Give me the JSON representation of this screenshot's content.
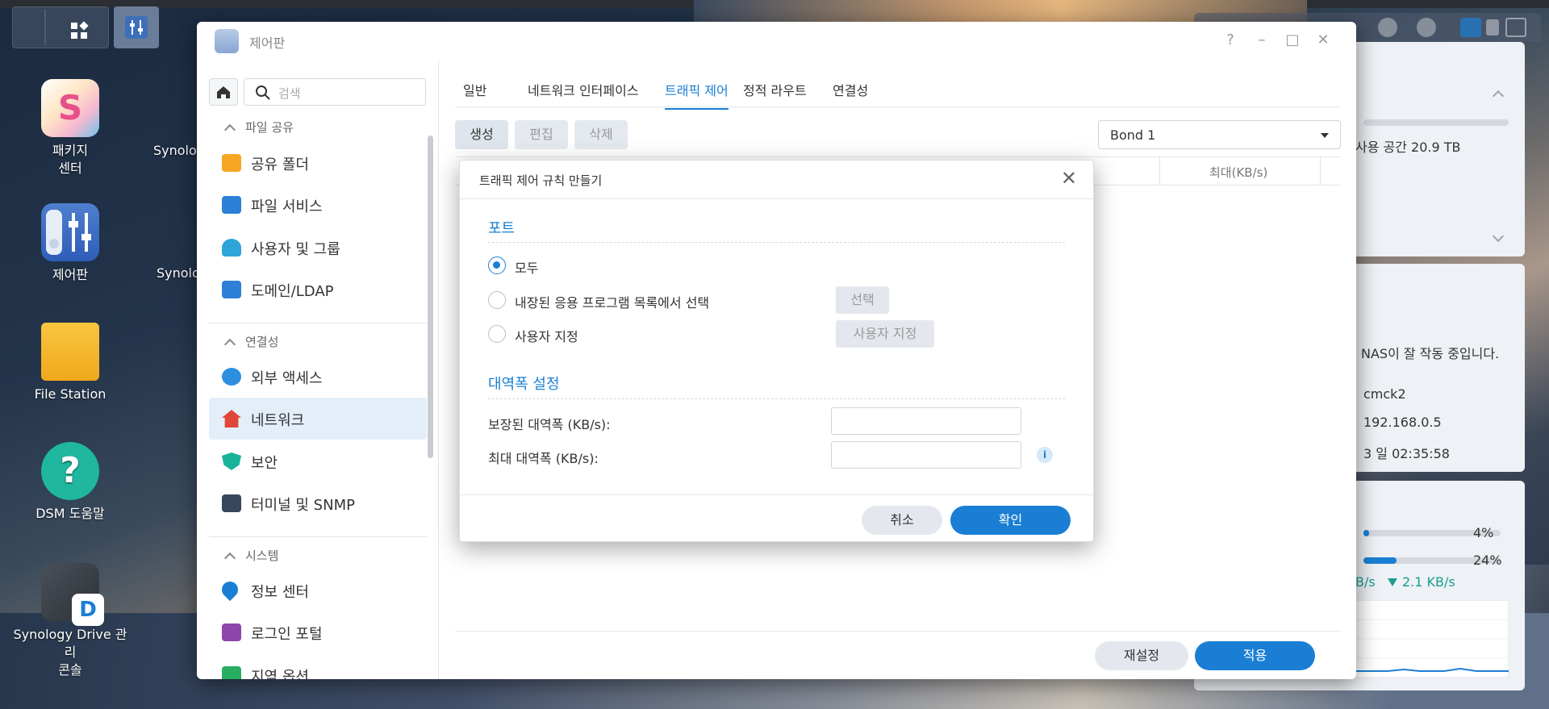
{
  "desktop": {
    "icons": [
      {
        "label_line1": "패키지",
        "label_line2": "센터"
      },
      {
        "label_line1": "제어판"
      },
      {
        "label_line1": "File Station"
      },
      {
        "label_line1": "DSM 도움말"
      },
      {
        "label_line1": "Synology Drive 관리",
        "label_line2": "콘솔"
      },
      {
        "label_line1": "Synolo"
      },
      {
        "label_line1": "Synolo"
      }
    ]
  },
  "widgets": {
    "storage_text": "사용 공간 20.9 TB",
    "health_text": "NAS이 잘 작동 중입니다.",
    "hostname": "cmck2",
    "ip": "192.168.0.5",
    "uptime": "3 일 02:35:58",
    "cpu": "4%",
    "ram": "24%",
    "upload": "B/s",
    "download": "2.1 KB/s",
    "cpu_level": 0.04,
    "ram_level": 0.24
  },
  "window": {
    "title": "제어판",
    "search_placeholder": "검색",
    "sidebar": {
      "sections": [
        {
          "label": "파일 공유"
        },
        {
          "label": "연결성"
        },
        {
          "label": "시스템"
        }
      ],
      "items": [
        {
          "label": "공유 폴더",
          "color": "#f5a623"
        },
        {
          "label": "파일 서비스",
          "color": "#2d7fd8"
        },
        {
          "label": "사용자 및 그룹",
          "color": "#2ea4d8"
        },
        {
          "label": "도메인/LDAP",
          "color": "#2d7fd8"
        },
        {
          "label": "외부 액세스",
          "color": "#2d8ee0"
        },
        {
          "label": "네트워크",
          "color": "#e0463a"
        },
        {
          "label": "보안",
          "color": "#18b39a"
        },
        {
          "label": "터미널 및 SNMP",
          "color": "#37475c"
        },
        {
          "label": "정보 센터",
          "color": "#1a7fd4"
        },
        {
          "label": "로그인 포털",
          "color": "#8e44ad"
        },
        {
          "label": "지역 옵션",
          "color": "#27ae60"
        }
      ]
    },
    "tabs": [
      "일반",
      "네트워크 인터페이스",
      "트래픽 제어",
      "정적 라우트",
      "연결성"
    ],
    "active_tab": "트래픽 제어",
    "toolbar": {
      "create": "생성",
      "edit": "편집",
      "delete": "삭제"
    },
    "interface_select": "Bond 1",
    "table_headers": {
      "max": "최대(KB/s)"
    },
    "footer": {
      "reset": "재설정",
      "apply": "적용"
    }
  },
  "dialog": {
    "title": "트래픽 제어 규칙 만들기",
    "port_section": "포트",
    "options": {
      "all": "모두",
      "builtin": "내장된 응용 프로그램 목록에서 선택",
      "custom": "사용자 지정"
    },
    "select_btn": "선택",
    "custom_btn": "사용자 지정",
    "bandwidth_section": "대역폭 설정",
    "guaranteed_label": "보장된 대역폭 (KB/s):",
    "max_label": "최대 대역폭 (KB/s):",
    "guaranteed_value": "",
    "max_value": "",
    "cancel": "취소",
    "ok": "확인"
  },
  "colors": {
    "accent": "#1a7fd4"
  }
}
